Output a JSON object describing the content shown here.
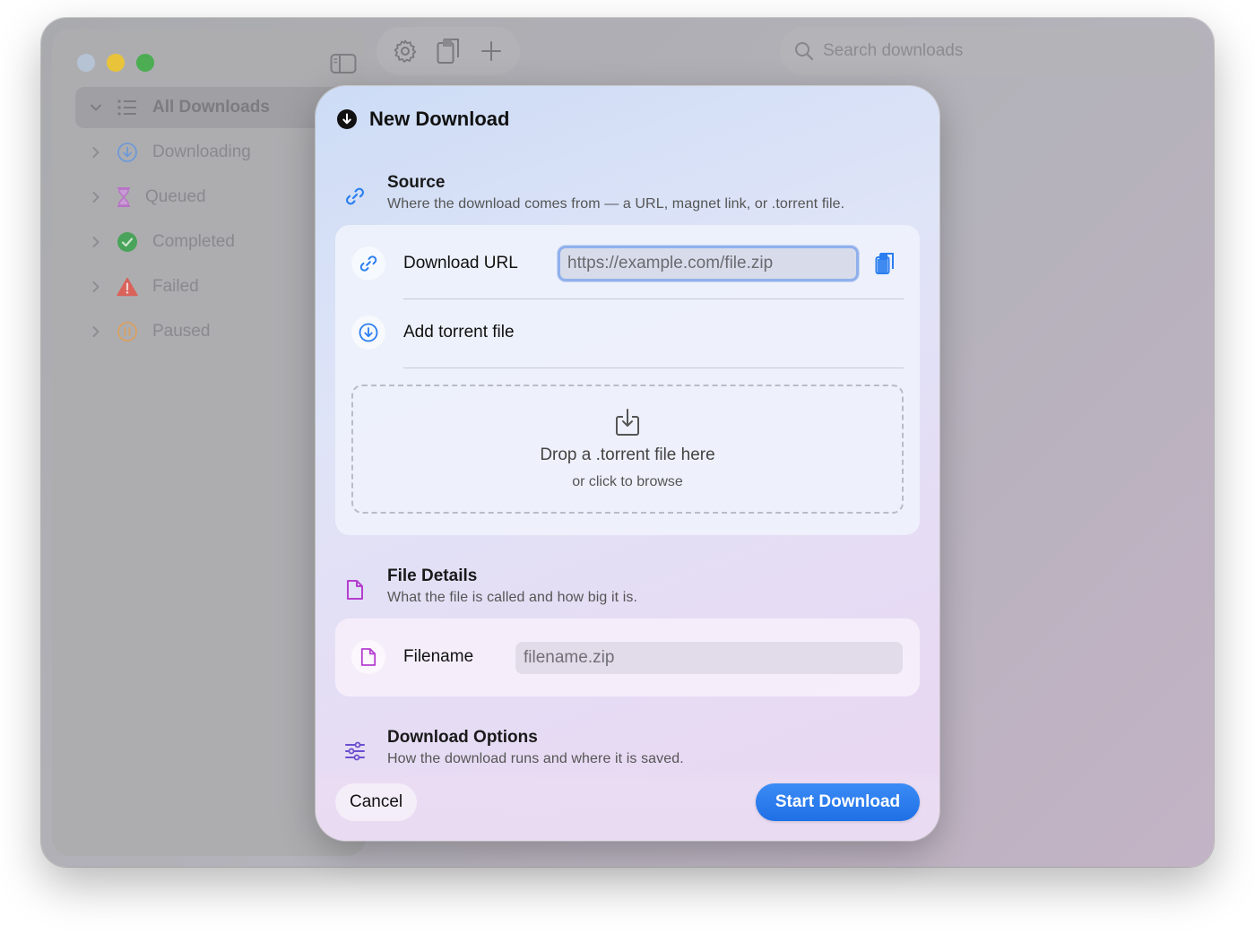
{
  "search": {
    "placeholder": "Search downloads"
  },
  "sidebar": {
    "items": [
      {
        "label": "All Downloads",
        "icon": "list-icon",
        "color": "#7c7c80"
      },
      {
        "label": "Downloading",
        "icon": "arrow-down-circle-icon",
        "color": "#6f9ad6"
      },
      {
        "label": "Queued",
        "icon": "hourglass-icon",
        "color": "#b872c6"
      },
      {
        "label": "Completed",
        "icon": "checkmark-circle-icon",
        "color": "#4aa35a"
      },
      {
        "label": "Failed",
        "icon": "warning-triangle-icon",
        "color": "#d9625a"
      },
      {
        "label": "Paused",
        "icon": "pause-circle-icon",
        "color": "#d9a060"
      }
    ]
  },
  "toolbar": {
    "settings": "gear-icon",
    "paste": "clipboard-icon",
    "add": "plus-icon"
  },
  "dialog": {
    "title": "New Download",
    "source": {
      "title": "Source",
      "description": "Where the download comes from — a URL, magnet link, or .torrent file.",
      "url_label": "Download URL",
      "url_placeholder": "https://example.com/file.zip",
      "torrent_label": "Add torrent file",
      "drop_main": "Drop a .torrent file here",
      "drop_sub": "or click to browse"
    },
    "file_details": {
      "title": "File Details",
      "description": "What the file is called and how big it is.",
      "filename_label": "Filename",
      "filename_placeholder": "filename.zip"
    },
    "options": {
      "title": "Download Options",
      "description": "How the download runs and where it is saved."
    },
    "cancel_label": "Cancel",
    "start_label": "Start Download",
    "accent": "#2a7ef0"
  }
}
